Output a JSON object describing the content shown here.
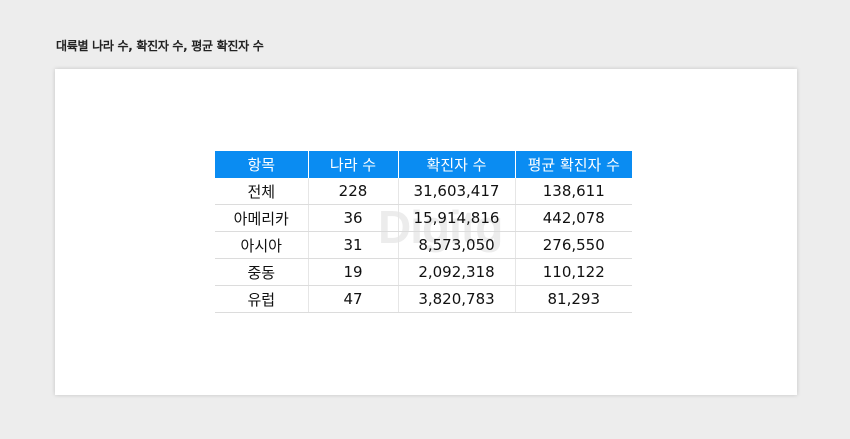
{
  "page": {
    "title": "대륙별 나라 수, 확진자 수, 평균 확진자 수",
    "watermark": "Digitg",
    "accent_color": "#0a8cf2"
  },
  "table": {
    "headers": [
      "항목",
      "나라 수",
      "확진자 수",
      "평균 확진자 수"
    ],
    "rows": [
      [
        "전체",
        "228",
        "31,603,417",
        "138,611"
      ],
      [
        "아메리카",
        "36",
        "15,914,816",
        "442,078"
      ],
      [
        "아시아",
        "31",
        "8,573,050",
        "276,550"
      ],
      [
        "중동",
        "19",
        "2,092,318",
        "110,122"
      ],
      [
        "유럽",
        "47",
        "3,820,783",
        "81,293"
      ]
    ]
  }
}
